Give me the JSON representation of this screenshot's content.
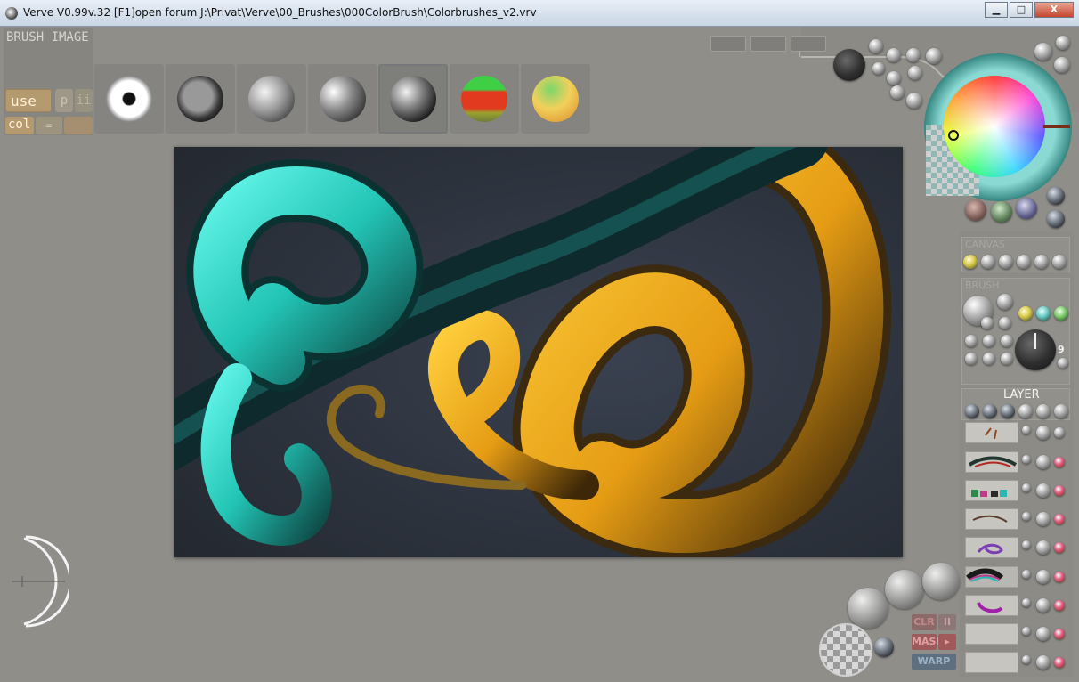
{
  "window": {
    "title": "Verve V0.99v.32 [F1]open forum    J:\\Privat\\Verve\\00_Brushes\\000ColorBrush\\Colorbrushes_v2.vrv",
    "minimize_glyph": "▁",
    "maximize_glyph": "□",
    "close_glyph": "X"
  },
  "brush_panel": {
    "title": "BRUSH  IMAGE",
    "use_label": "use",
    "p_label": "p",
    "ii_label": "ii",
    "col_label": "col",
    "eq_label": "="
  },
  "brush_images": [
    {
      "name": "brush-image-1"
    },
    {
      "name": "brush-image-2"
    },
    {
      "name": "brush-image-3"
    },
    {
      "name": "brush-image-4"
    },
    {
      "name": "brush-image-5",
      "selected": true
    },
    {
      "name": "brush-image-6"
    },
    {
      "name": "brush-image-7"
    }
  ],
  "right_panel": {
    "canvas_label": "CANVAS",
    "brush_label": "BRUSH",
    "brush_size_value": "9",
    "layer_label": "LAYER"
  },
  "bottom_buttons": {
    "clr_label": "CLR",
    "ii_label": "II",
    "mask_label": "MASK",
    "mask_arrow": "▸",
    "warp_label": "WARP"
  },
  "colors": {
    "workspace_bg": "#8f8e89",
    "canvas_bg": "#2c323e",
    "stroke_cyan": "#2fd3c4",
    "stroke_gold": "#e8a61f",
    "accent_tan": "#b49a6e"
  }
}
